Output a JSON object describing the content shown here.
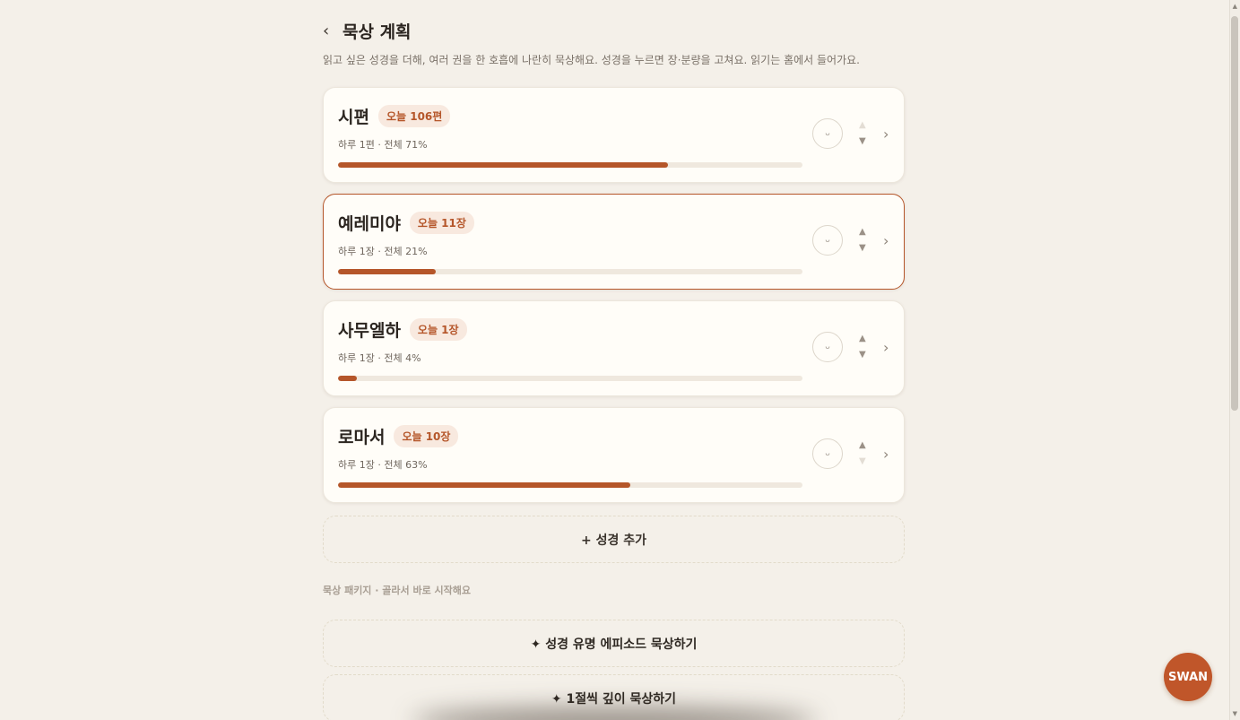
{
  "header": {
    "back_icon": "‹",
    "title": "묵상 계획"
  },
  "subtitle": "읽고 싶은 성경을 더해, 여러 권을 한 호흡에 나란히 묵상해요. 성경을 누르면 장·분량을 고쳐요. 읽기는 홈에서 들어가요.",
  "colors": {
    "accent": "#b5562a",
    "background": "#f4f0e9",
    "card": "#fffdf8",
    "badge_bg": "#f8e9df"
  },
  "plans": [
    {
      "title": "시편",
      "today": "오늘 106편",
      "meta": "하루 1편 · 전체 71%",
      "progress": 0.71,
      "up_enabled": false,
      "down_enabled": true,
      "selected": false
    },
    {
      "title": "예레미야",
      "today": "오늘 11장",
      "meta": "하루 1장 · 전체 21%",
      "progress": 0.21,
      "up_enabled": true,
      "down_enabled": true,
      "selected": true
    },
    {
      "title": "사무엘하",
      "today": "오늘 1장",
      "meta": "하루 1장 · 전체 4%",
      "progress": 0.04,
      "up_enabled": true,
      "down_enabled": true,
      "selected": false
    },
    {
      "title": "로마서",
      "today": "오늘 10장",
      "meta": "하루 1장 · 전체 63%",
      "progress": 0.63,
      "up_enabled": true,
      "down_enabled": false,
      "selected": false
    }
  ],
  "icons": {
    "check": "check-circle-icon",
    "up": "▲",
    "down": "▼",
    "chevron": "›",
    "check_glyph": "ᴗ"
  },
  "add_button": "+ 성경 추가",
  "packages_label": "묵상 패키지 · 골라서 바로 시작해요",
  "packages": [
    "✦ 성경 유명 에피소드 묵상하기",
    "✦ 1절씩 깊이 묵상하기"
  ],
  "fab_label": "SWAN"
}
